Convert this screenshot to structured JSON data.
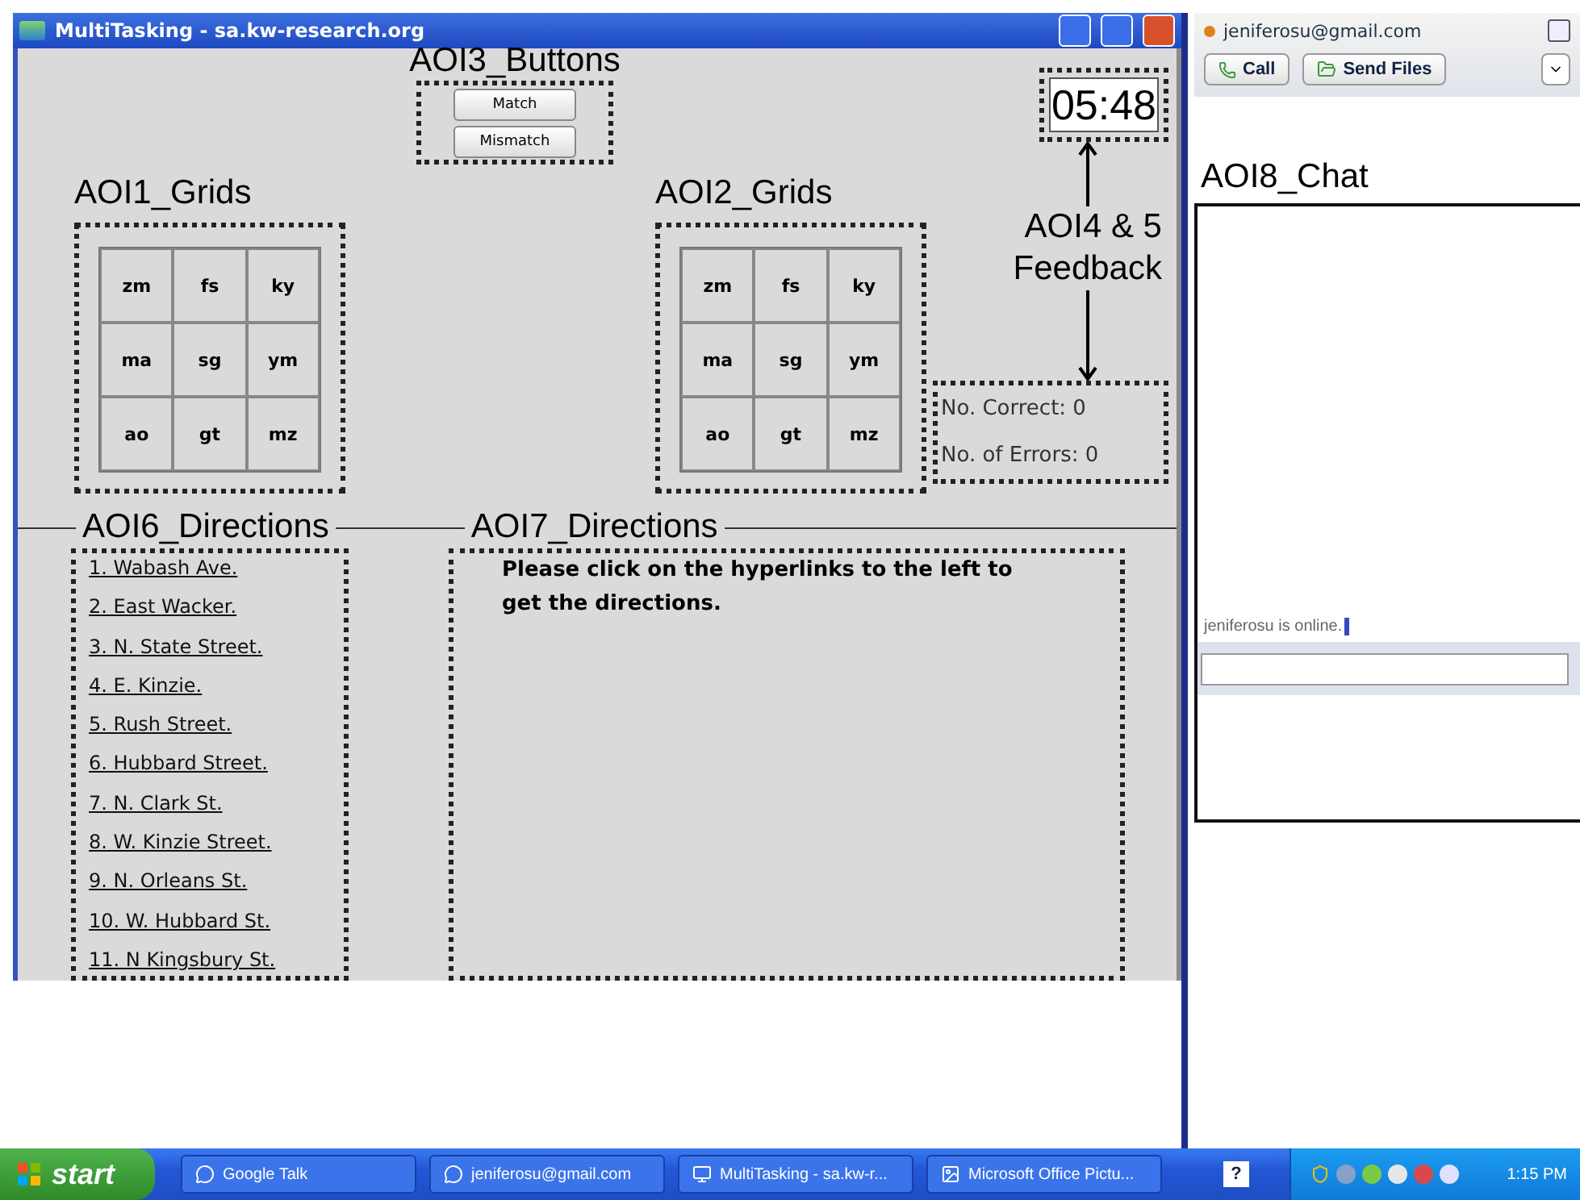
{
  "main_window": {
    "title": "MultiTasking - sa.kw-research.org",
    "timer": "05:48"
  },
  "buttons_area": {
    "annotation": "AOI3_Buttons",
    "buttons": [
      "Match",
      "Mismatch"
    ]
  },
  "grids": [
    {
      "annotation": "AOI1_Grids",
      "cells": [
        "zm",
        "fs",
        "ky",
        "ma",
        "sg",
        "ym",
        "ao",
        "gt",
        "mz"
      ]
    },
    {
      "annotation": "AOI2_Grids",
      "cells": [
        "zm",
        "fs",
        "ky",
        "ma",
        "sg",
        "ym",
        "ao",
        "gt",
        "mz"
      ]
    }
  ],
  "feedback": {
    "annotation": "AOI4 & 5 Feedback",
    "correct": "No. Correct: 0",
    "errors": "No. of Errors: 0"
  },
  "directions_list": {
    "annotation": "AOI6_Directions",
    "links": [
      "1. Wabash Ave.",
      "2. East Wacker.",
      "3. N. State Street.",
      "4. E. Kinzie.",
      "5. Rush Street.",
      "6. Hubbard Street.",
      "7. N. Clark St.",
      "8. W. Kinzie Street.",
      "9. N. Orleans St.",
      "10. W. Hubbard St.",
      "11. N Kingsbury St."
    ]
  },
  "directions_panel": {
    "annotation": "AOI7_Directions",
    "text": "Please click on the hyperlinks to the left to get the directions."
  },
  "chat_window": {
    "title": "jeniferosu@gmail.com",
    "buttons": [
      "Call",
      "Send Files"
    ],
    "annotation": "AOI8_Chat",
    "messages": [
      "jeniferosu is online."
    ]
  },
  "taskbar": {
    "start": "start",
    "tasks": [
      "Google Talk",
      "jeniferosu@gmail.com",
      "MultiTasking - sa.kw-r...",
      "Microsoft Office Pictu..."
    ],
    "help": "?",
    "clock": "1:15 PM"
  }
}
